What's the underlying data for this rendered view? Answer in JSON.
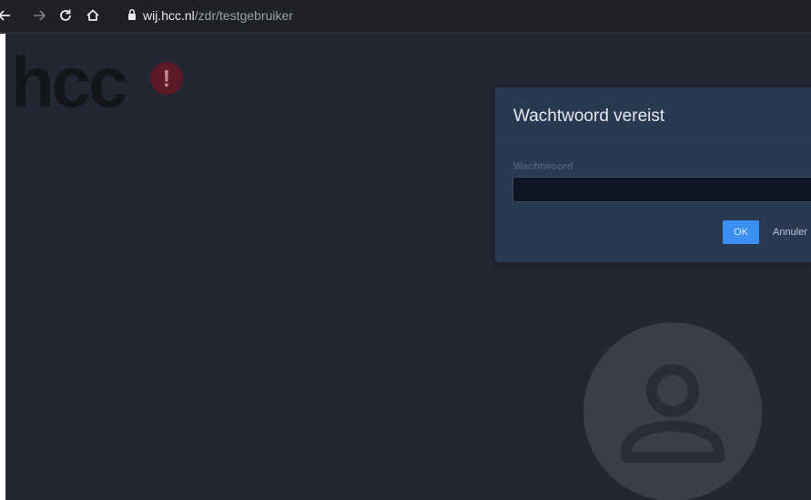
{
  "browser": {
    "url_host": "wij.hcc.nl",
    "url_path": "/zdr/testgebruiker"
  },
  "logo": {
    "text": "hcc",
    "badge": "!"
  },
  "dialog": {
    "title": "Wachtwoord vereist",
    "field_label": "Wachtwoord",
    "password_value": "",
    "ok_label": "OK",
    "cancel_label": "Annuler"
  },
  "icons": {
    "back": "back-arrow-icon",
    "forward": "forward-arrow-icon",
    "reload": "reload-icon",
    "home": "home-icon",
    "lock": "lock-icon",
    "avatar": "user-avatar-icon"
  },
  "colors": {
    "page_background": "#232633",
    "dialog_background": "#2a3952",
    "ok_button": "#3b8ff0",
    "logo_badge": "#5c1a26"
  }
}
